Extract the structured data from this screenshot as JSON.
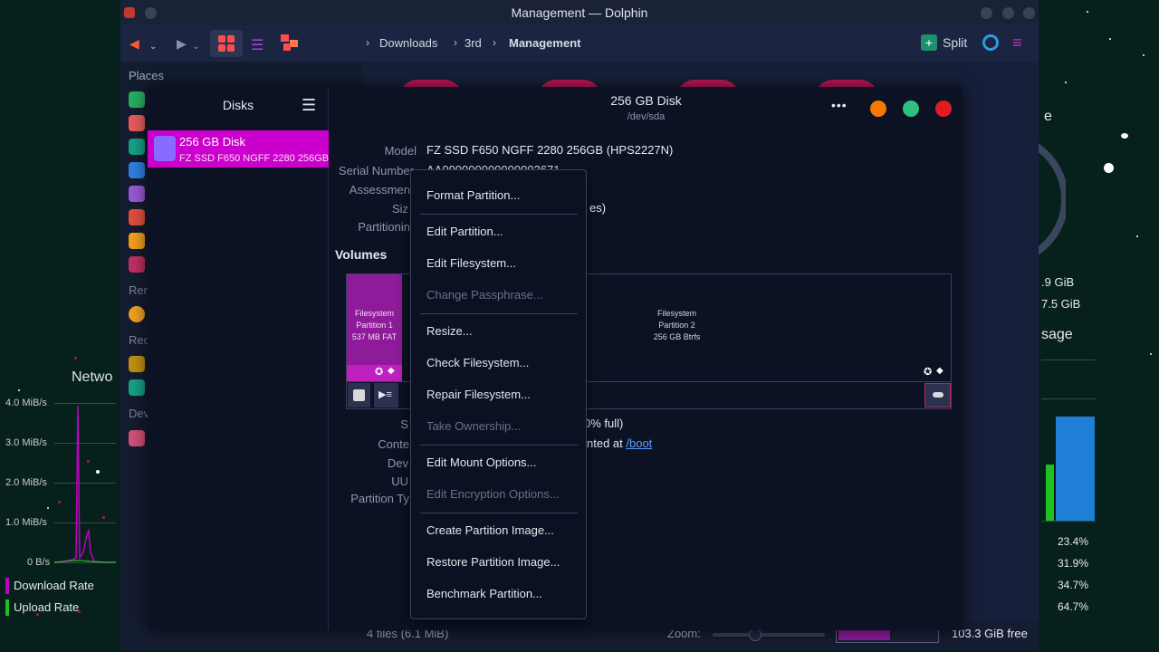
{
  "window": {
    "title": "Management — Dolphin"
  },
  "toolbar": {
    "breadcrumbs": [
      "Downloads",
      "3rd",
      "Management"
    ],
    "split_label": "Split"
  },
  "places": {
    "header": "Places",
    "section_remote": "Ren",
    "section_recent": "Rec",
    "section_devices": "Dev"
  },
  "status": {
    "files": "4 files (6.1 MiB)",
    "zoom_label": "Zoom:",
    "free": "103.3 GiB free"
  },
  "pm": {
    "sidebar_title": "Disks",
    "disk": {
      "name": "256 GB Disk",
      "model": "FZ SSD F650 NGFF 2280 256GB"
    },
    "header_title": "256 GB Disk",
    "header_subtitle": "/dev/sda",
    "details": {
      "model_label": "Model",
      "model_value": "FZ SSD F650 NGFF 2280 256GB (HPS2227N)",
      "serial_label": "Serial Number",
      "serial_value": "AA000000000000002671",
      "assessment_label": "Assessmen",
      "size_label": "Siz",
      "size_value_tail": "es)",
      "partitioning_label": "Partitionin"
    },
    "volumes_title": "Volumes",
    "partitions": [
      {
        "line1": "Filesystem",
        "line2": "Partition 1",
        "line3": "537 MB FAT"
      },
      {
        "line1": "Filesystem",
        "line2": "Partition 2",
        "line3": "256 GB Btrfs"
      }
    ],
    "volume_details": {
      "size_label": "S",
      "size_value_tail": "0% full)",
      "contents_label": "Conte",
      "contents_value_tail": "nted at ",
      "mount_link": "/boot",
      "device_label": "Dev",
      "uuid_label": "UU",
      "ptype_label": "Partition Ty"
    }
  },
  "menu": {
    "items": [
      {
        "label": "Format Partition...",
        "enabled": true
      },
      {
        "label": "Edit Partition...",
        "enabled": true
      },
      {
        "label": "Edit Filesystem...",
        "enabled": true
      },
      {
        "label": "Change Passphrase...",
        "enabled": false
      },
      {
        "label": "Resize...",
        "enabled": true
      },
      {
        "label": "Check Filesystem...",
        "enabled": true
      },
      {
        "label": "Repair Filesystem...",
        "enabled": true
      },
      {
        "label": "Take Ownership...",
        "enabled": false
      },
      {
        "label": "Edit Mount Options...",
        "enabled": true
      },
      {
        "label": "Edit Encryption Options...",
        "enabled": false
      },
      {
        "label": "Create Partition Image...",
        "enabled": true
      },
      {
        "label": "Restore Partition Image...",
        "enabled": true
      },
      {
        "label": "Benchmark Partition...",
        "enabled": true
      }
    ]
  },
  "network_widget": {
    "title": "Netwo",
    "y_ticks": [
      "4.0 MiB/s",
      "3.0 MiB/s",
      "2.0 MiB/s",
      "1.0 MiB/s",
      "0 B/s"
    ],
    "legend_download": "Download Rate",
    "legend_upload": "Upload Rate"
  },
  "system_widget": {
    "title_partial": "e",
    "mem_values": [
      ".9 GiB",
      "7.5 GiB"
    ],
    "usage_label": "sage",
    "percentages": [
      "23.4%",
      "31.9%",
      "34.7%",
      "64.7%"
    ]
  },
  "colors": {
    "accent_magenta": "#cc00cc",
    "window_close": "#e01b24",
    "window_max": "#2ec27e",
    "window_min": "#f57900",
    "download": "#c000c0",
    "upload": "#1fbf1f",
    "bar_blue": "#1f7fd6"
  }
}
